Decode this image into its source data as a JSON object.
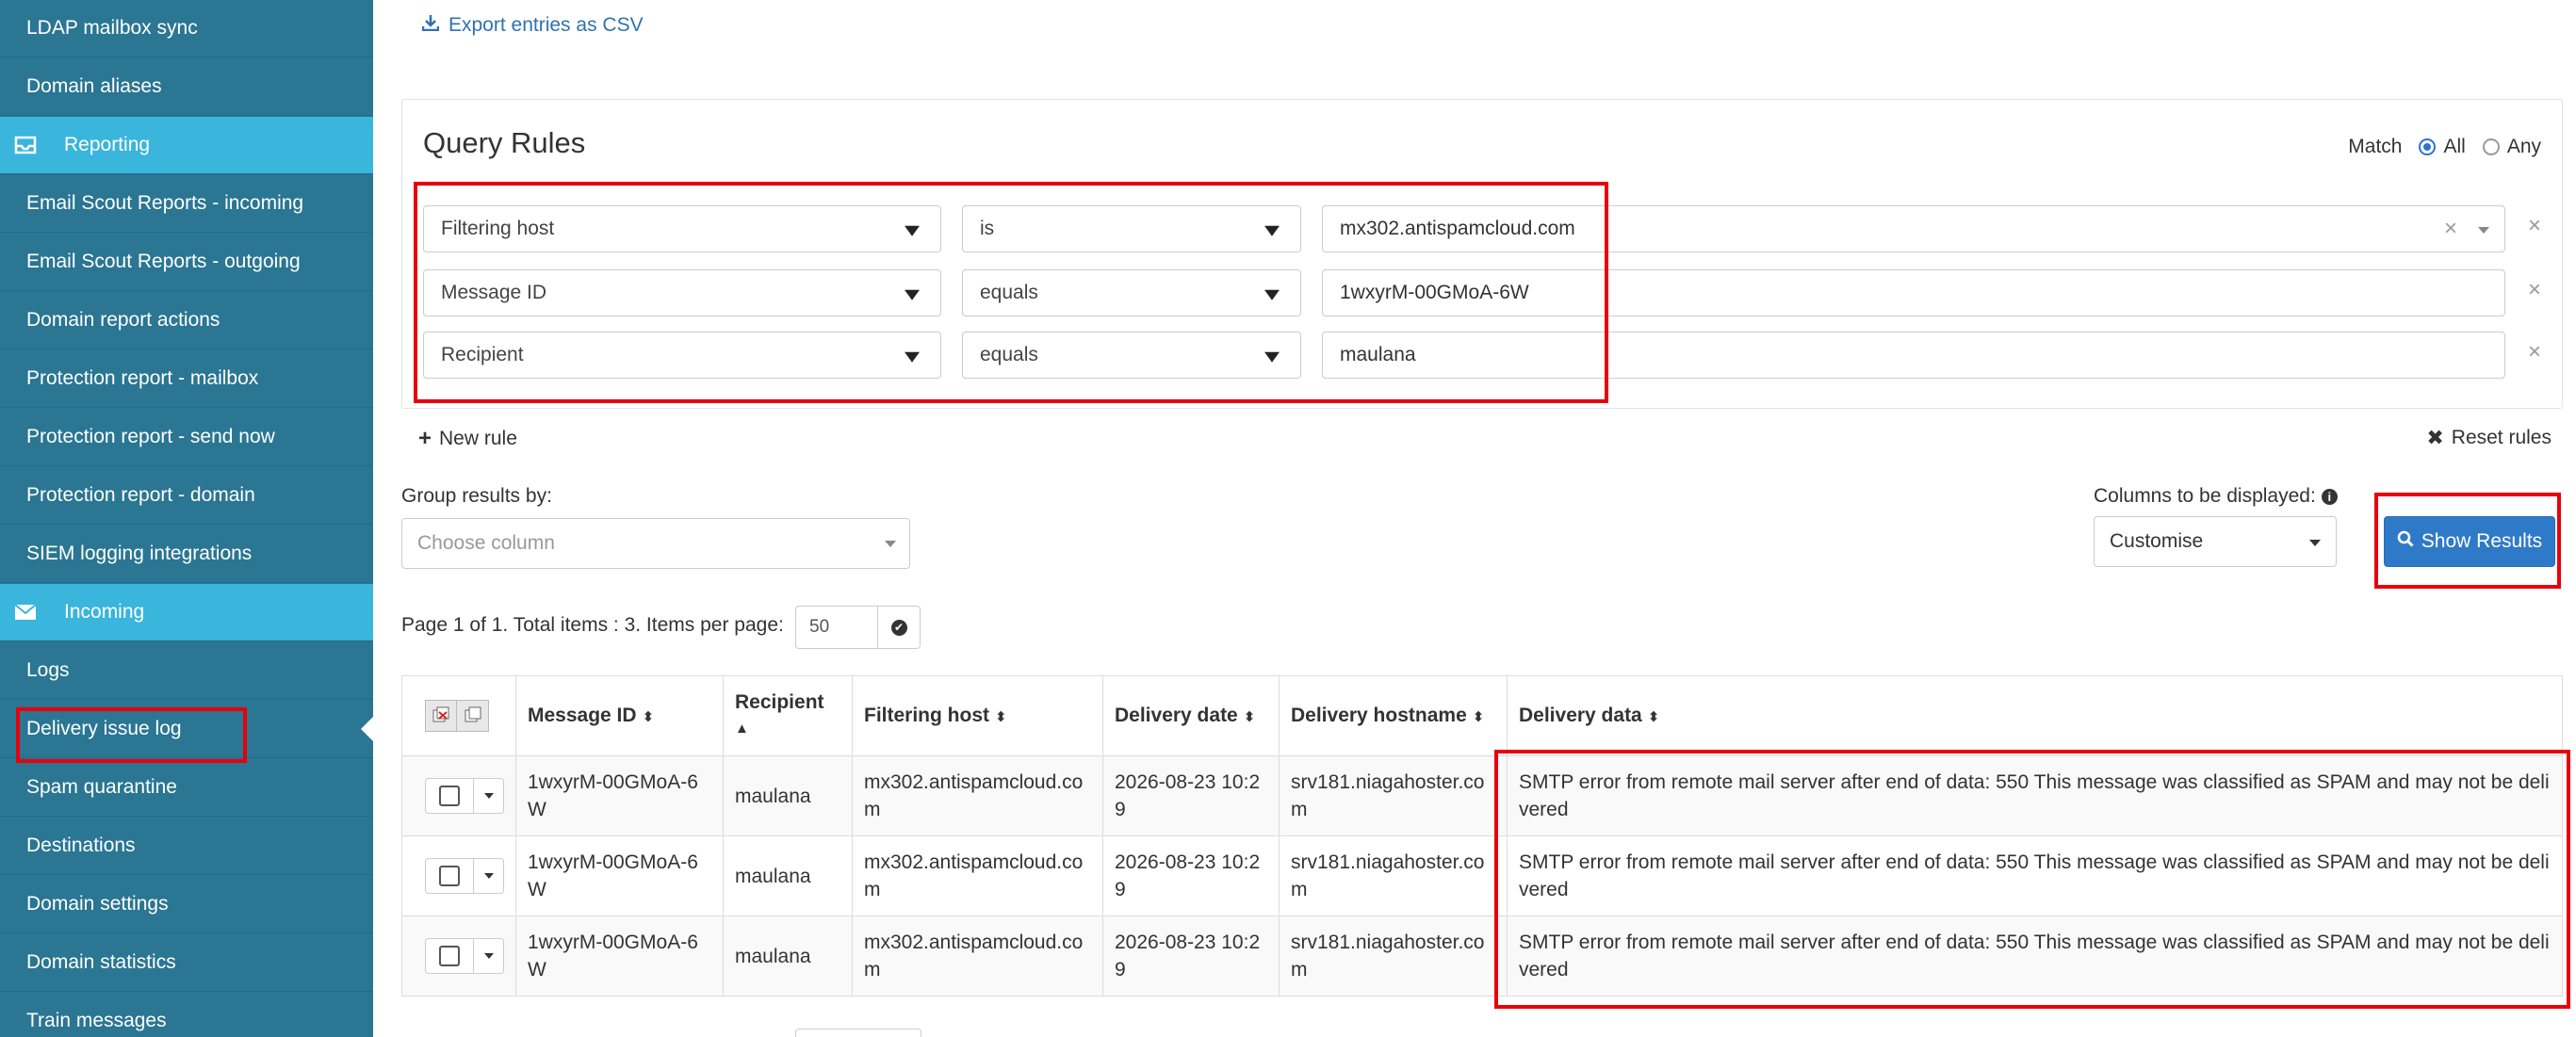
{
  "sidebar": {
    "items": [
      {
        "label": "LDAP mailbox sync",
        "type": "item"
      },
      {
        "label": "Domain aliases",
        "type": "item"
      },
      {
        "label": "Reporting",
        "type": "section",
        "icon": "inbox-icon"
      },
      {
        "label": "Email Scout Reports - incoming",
        "type": "item"
      },
      {
        "label": "Email Scout Reports - outgoing",
        "type": "item"
      },
      {
        "label": "Domain report actions",
        "type": "item"
      },
      {
        "label": "Protection report - mailbox",
        "type": "item"
      },
      {
        "label": "Protection report - send now",
        "type": "item"
      },
      {
        "label": "Protection report - domain",
        "type": "item"
      },
      {
        "label": "SIEM logging integrations",
        "type": "item"
      },
      {
        "label": "Incoming",
        "type": "section",
        "icon": "envelope-icon"
      },
      {
        "label": "Logs",
        "type": "item"
      },
      {
        "label": "Delivery issue log",
        "type": "item",
        "active": true
      },
      {
        "label": "Spam quarantine",
        "type": "item"
      },
      {
        "label": "Destinations",
        "type": "item"
      },
      {
        "label": "Domain settings",
        "type": "item"
      },
      {
        "label": "Domain statistics",
        "type": "item"
      },
      {
        "label": "Train messages",
        "type": "item"
      }
    ]
  },
  "export": {
    "label": "Export entries as CSV",
    "icon": "download-icon"
  },
  "query_rules": {
    "title": "Query Rules",
    "match_label": "Match",
    "match_all": "All",
    "match_any": "Any",
    "match_selected": "All",
    "rules": [
      {
        "field": "Filtering host",
        "operator": "is",
        "value": "mx302.antispamcloud.com"
      },
      {
        "field": "Message ID",
        "operator": "equals",
        "value": "1wxyrM-00GMoA-6W"
      },
      {
        "field": "Recipient",
        "operator": "equals",
        "value": "maulana"
      }
    ],
    "new_rule": "New rule",
    "reset_rules": "Reset rules"
  },
  "grouping": {
    "label": "Group results by:",
    "placeholder": "Choose column"
  },
  "columns": {
    "label": "Columns to be displayed:",
    "value": "Customise"
  },
  "show_results": "Show Results",
  "pager": {
    "text": "Page 1 of 1. Total items : 3. Items per page:",
    "per_page": "50"
  },
  "table": {
    "headers": [
      "Message ID",
      "Recipient",
      "Filtering host",
      "Delivery date",
      "Delivery hostname",
      "Delivery data"
    ],
    "rows": [
      {
        "message_id": "1wxyrM-00GMoA-6W",
        "recipient": "maulana",
        "filtering_host": "mx302.antispamcloud.com",
        "delivery_date": "2026-08-23 10:29",
        "delivery_hostname": "srv181.niagahoster.com",
        "delivery_data": "SMTP error from remote mail server after end of data: 550 This message was classified as SPAM and may not be delivered"
      },
      {
        "message_id": "1wxyrM-00GMoA-6W",
        "recipient": "maulana",
        "filtering_host": "mx302.antispamcloud.com",
        "delivery_date": "2026-08-23 10:29",
        "delivery_hostname": "srv181.niagahoster.com",
        "delivery_data": "SMTP error from remote mail server after end of data: 550 This message was classified as SPAM and may not be delivered"
      },
      {
        "message_id": "1wxyrM-00GMoA-6W",
        "recipient": "maulana",
        "filtering_host": "mx302.antispamcloud.com",
        "delivery_date": "2026-08-23 10:29",
        "delivery_hostname": "srv181.niagahoster.com",
        "delivery_data": "SMTP error from remote mail server after end of data: 550 This message was classified as SPAM and may not be delivered"
      }
    ]
  },
  "colors": {
    "sidebar": "#2a7693",
    "section": "#3ab5dc",
    "primary": "#2f7ac8",
    "highlight": "#e8000b"
  }
}
